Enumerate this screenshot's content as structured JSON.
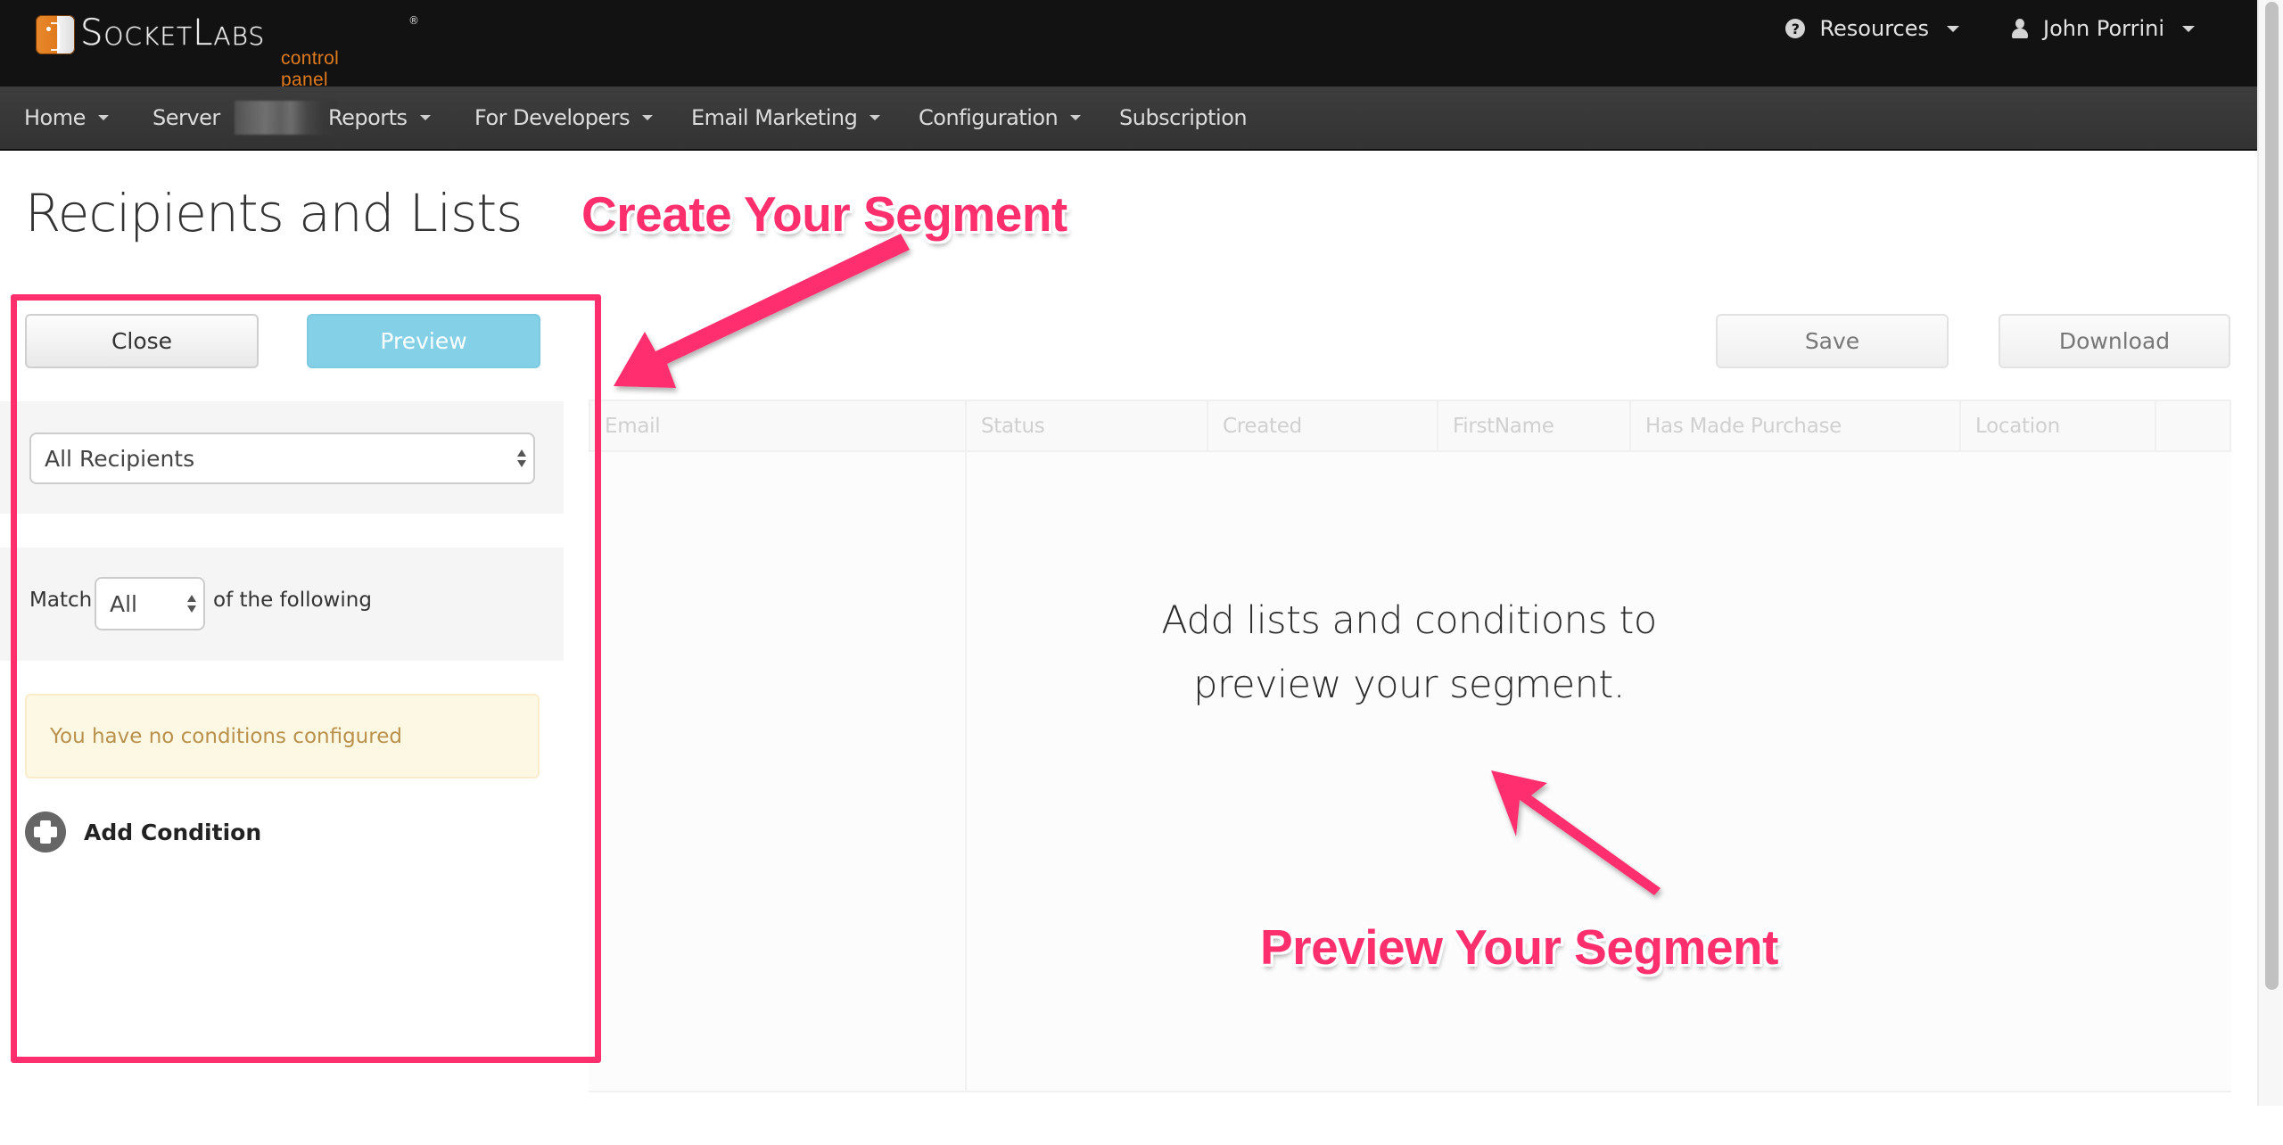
{
  "header": {
    "logo": {
      "brand": "SocketLabs",
      "registered": "®",
      "subtitle": "control panel"
    },
    "right_menu": [
      {
        "label": "Resources",
        "icon": "question-circle-icon"
      },
      {
        "label": "John Porrini",
        "icon": "user-icon"
      }
    ]
  },
  "nav": {
    "items": [
      {
        "label": "Home",
        "has_dropdown": true
      },
      {
        "label": "Server",
        "has_dropdown": false,
        "redacted_value": true
      },
      {
        "label": "Reports",
        "has_dropdown": true
      },
      {
        "label": "For Developers",
        "has_dropdown": true
      },
      {
        "label": "Email Marketing",
        "has_dropdown": true
      },
      {
        "label": "Configuration",
        "has_dropdown": true
      },
      {
        "label": "Subscription",
        "has_dropdown": false
      }
    ]
  },
  "page": {
    "title": "Recipients and Lists"
  },
  "segment_builder": {
    "close_label": "Close",
    "preview_label": "Preview",
    "source_select": {
      "selected": "All Recipients"
    },
    "match": {
      "prefix": "Match",
      "selected": "All",
      "suffix": "of the following"
    },
    "alert": "You have no conditions configured",
    "add_condition_label": "Add Condition"
  },
  "results": {
    "save_label": "Save",
    "download_label": "Download",
    "columns": [
      "Email",
      "Status",
      "Created",
      "FirstName",
      "Has Made Purchase",
      "Location",
      ""
    ],
    "empty_message_line1": "Add lists and conditions to",
    "empty_message_line2": "preview your segment."
  },
  "annotations": {
    "create": "Create Your Segment",
    "preview": "Preview Your Segment",
    "color": "#ff2f6e"
  },
  "colors": {
    "topbar": "#121212",
    "navbar": "#383838",
    "logo_orange": "#e07a1c",
    "info_button": "#84d0e6",
    "alert_bg": "#fcf8e3",
    "alert_text": "#b9914c"
  }
}
